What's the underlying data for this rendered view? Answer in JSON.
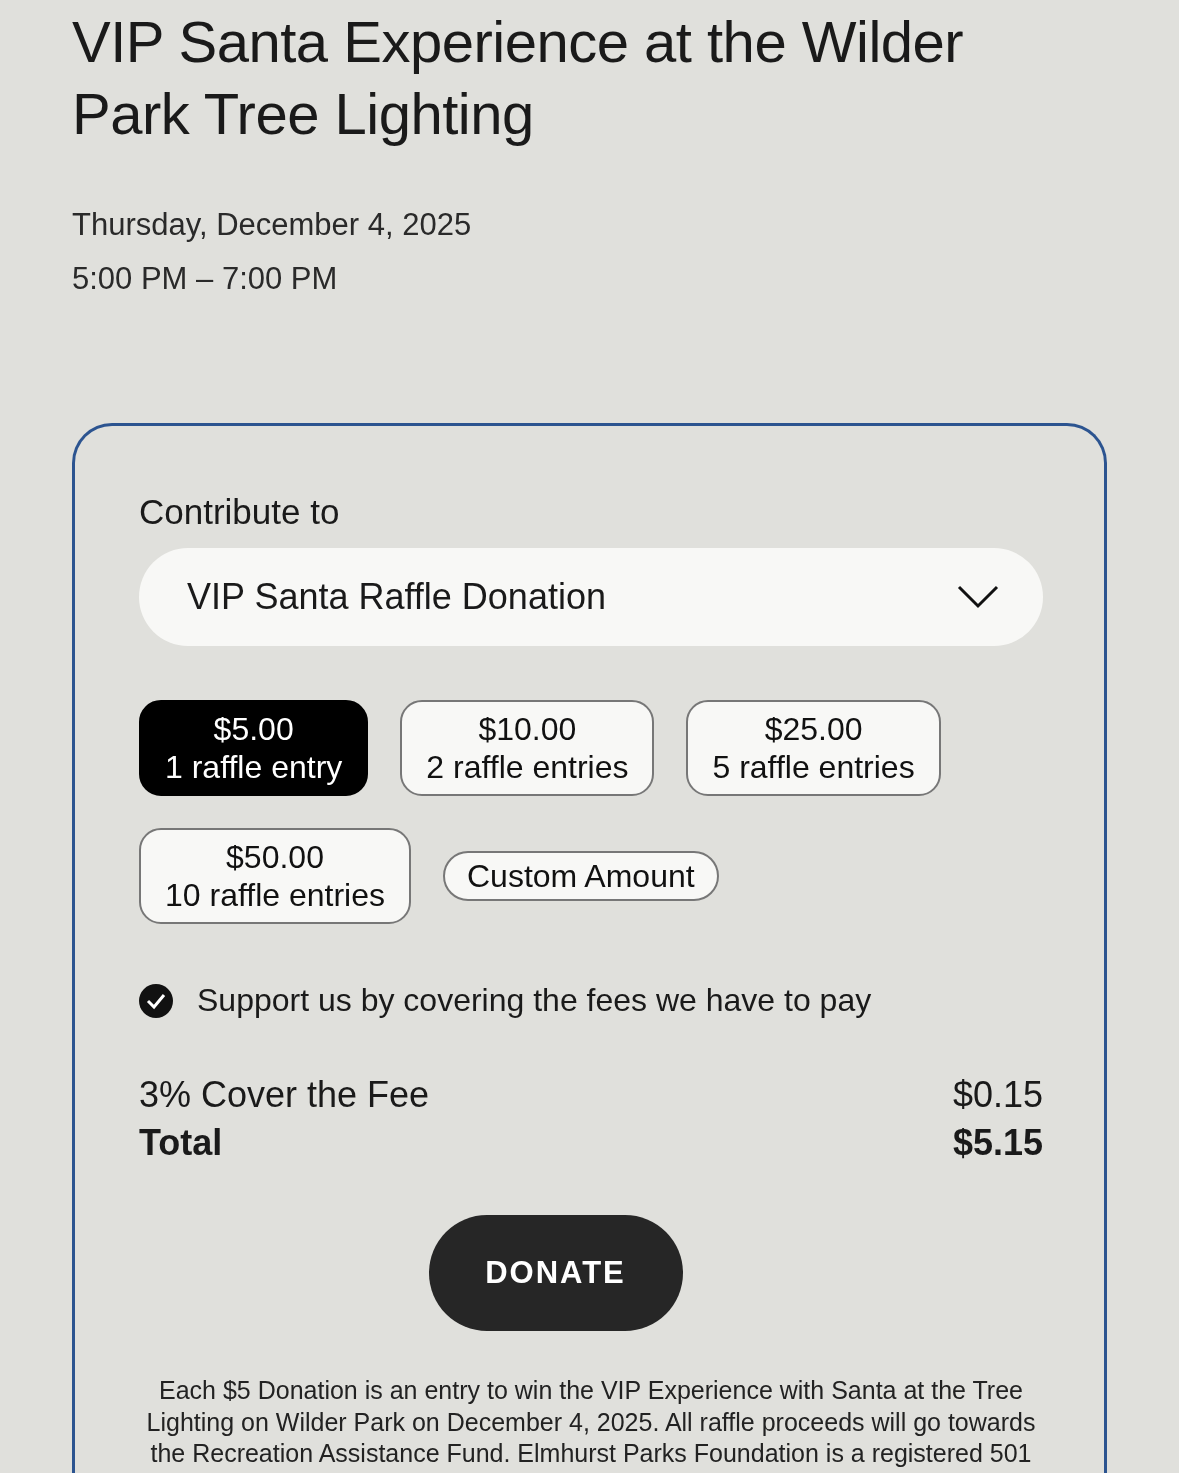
{
  "event": {
    "title": "VIP Santa Experience at the Wilder Park Tree Lighting",
    "date": "Thursday, December 4, 2025",
    "time": "5:00 PM – 7:00 PM"
  },
  "form": {
    "contribute_label": "Contribute to",
    "fund": {
      "value": "VIP Santa Raffle Donation"
    },
    "options": [
      {
        "kind": "preset",
        "amount": "$5.00",
        "entries": "1 raffle entry",
        "selected": true
      },
      {
        "kind": "preset",
        "amount": "$10.00",
        "entries": "2 raffle entries",
        "selected": false
      },
      {
        "kind": "preset",
        "amount": "$25.00",
        "entries": "5 raffle entries",
        "selected": false
      },
      {
        "kind": "preset",
        "amount": "$50.00",
        "entries": "10 raffle entries",
        "selected": false
      },
      {
        "kind": "custom",
        "label": "Custom Amount",
        "selected": false
      }
    ],
    "cover_fees": {
      "label": "Support us by covering the fees we have to pay",
      "checked": true
    },
    "fee": {
      "label": "3% Cover the Fee",
      "value": "$0.15"
    },
    "total": {
      "label": "Total",
      "value": "$5.15"
    },
    "donate_button": "DONATE",
    "note": "Each $5 Donation is an entry to win the VIP Experience with Santa at the Tree Lighting on Wilder Park on December 4, 2025. All raffle proceeds will go towards the Recreation Assistance Fund. Elmhurst Parks Foundation is a registered 501"
  }
}
